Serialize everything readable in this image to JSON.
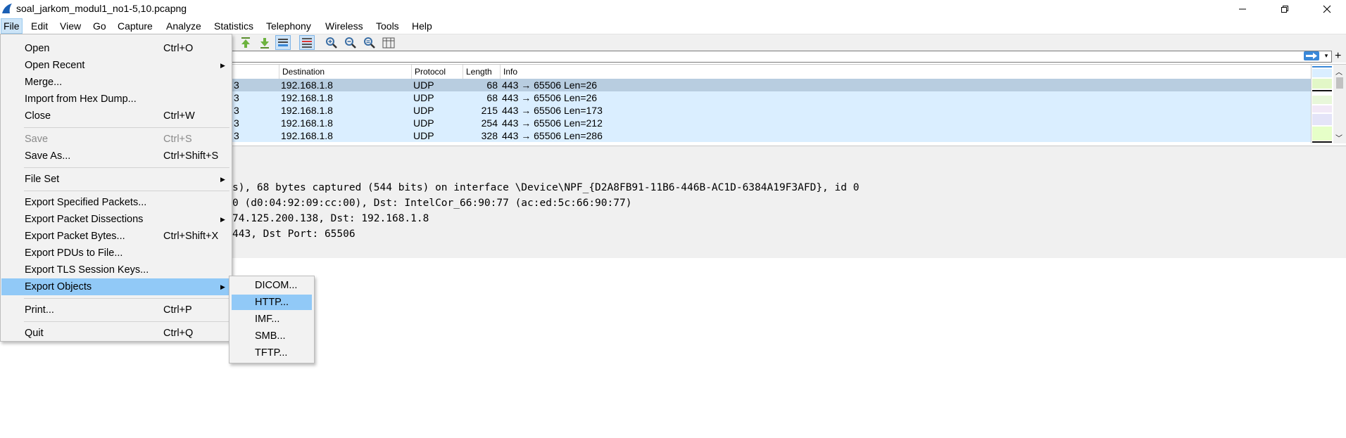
{
  "window": {
    "title": "soal_jarkom_modul1_no1-5,10.pcapng"
  },
  "menubar": {
    "items": [
      "File",
      "Edit",
      "View",
      "Go",
      "Capture",
      "Analyze",
      "Statistics",
      "Telephony",
      "Wireless",
      "Tools",
      "Help"
    ]
  },
  "packet_list": {
    "columns": [
      "Destination",
      "Protocol",
      "Length",
      "Info"
    ],
    "rows": [
      {
        "src_tail": "3",
        "destination": "192.168.1.8",
        "protocol": "UDP",
        "length": "68",
        "info": "443 → 65506 Len=26",
        "selected": true
      },
      {
        "src_tail": "3",
        "destination": "192.168.1.8",
        "protocol": "UDP",
        "length": "68",
        "info": "443 → 65506 Len=26"
      },
      {
        "src_tail": "3",
        "destination": "192.168.1.8",
        "protocol": "UDP",
        "length": "215",
        "info": "443 → 65506 Len=173"
      },
      {
        "src_tail": "3",
        "destination": "192.168.1.8",
        "protocol": "UDP",
        "length": "254",
        "info": "443 → 65506 Len=212"
      },
      {
        "src_tail": "3",
        "destination": "192.168.1.8",
        "protocol": "UDP",
        "length": "328",
        "info": "443 → 65506 Len=286"
      }
    ]
  },
  "details": {
    "lines": [
      "s), 68 bytes captured (544 bits) on interface \\Device\\NPF_{D2A8FB91-11B6-446B-AC1D-6384A19F3AFD}, id 0",
      "0 (d0:04:92:09:cc:00), Dst: IntelCor_66:90:77 (ac:ed:5c:66:90:77)",
      "74.125.200.138, Dst: 192.168.1.8",
      "443, Dst Port: 65506"
    ]
  },
  "file_menu": {
    "items": [
      {
        "label": "Open",
        "shortcut": "Ctrl+O"
      },
      {
        "label": "Open Recent",
        "submenu": true
      },
      {
        "label": "Merge..."
      },
      {
        "label": "Import from Hex Dump..."
      },
      {
        "label": "Close",
        "shortcut": "Ctrl+W"
      },
      {
        "label": "Save",
        "shortcut": "Ctrl+S",
        "disabled": true
      },
      {
        "label": "Save As...",
        "shortcut": "Ctrl+Shift+S"
      },
      {
        "label": "File Set",
        "submenu": true
      },
      {
        "label": "Export Specified Packets..."
      },
      {
        "label": "Export Packet Dissections",
        "submenu": true
      },
      {
        "label": "Export Packet Bytes...",
        "shortcut": "Ctrl+Shift+X"
      },
      {
        "label": "Export PDUs to File..."
      },
      {
        "label": "Export TLS Session Keys..."
      },
      {
        "label": "Export Objects",
        "submenu": true,
        "highlighted": true
      },
      {
        "label": "Print...",
        "shortcut": "Ctrl+P"
      },
      {
        "label": "Quit",
        "shortcut": "Ctrl+Q"
      }
    ]
  },
  "export_objects_menu": {
    "items": [
      {
        "label": "DICOM..."
      },
      {
        "label": "HTTP...",
        "highlighted": true
      },
      {
        "label": "IMF..."
      },
      {
        "label": "SMB..."
      },
      {
        "label": "TFTP..."
      }
    ]
  },
  "colors": {
    "menu_highlight": "#91c9f7",
    "row_bg": "#daeeff",
    "row_selected": "#b8cde0"
  },
  "icons": [
    "wireshark-fin-icon",
    "minimize-icon",
    "restore-icon",
    "close-icon",
    "go-first-icon",
    "go-last-icon",
    "autoscroll-icon",
    "colorize-icon",
    "zoom-in-icon",
    "zoom-out-icon",
    "zoom-normal-icon",
    "resize-columns-icon"
  ]
}
